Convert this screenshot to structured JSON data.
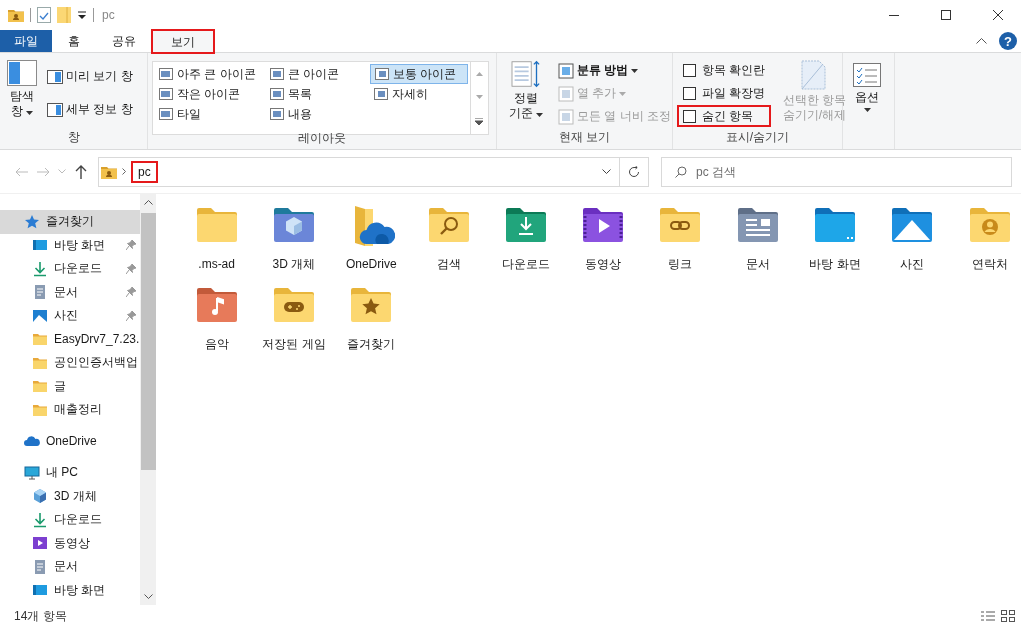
{
  "window": {
    "title": "pc"
  },
  "ribbon": {
    "tabs": [
      {
        "label": "파일",
        "kind": "file",
        "selected": false,
        "highlighted": false
      },
      {
        "label": "홈",
        "kind": "tab",
        "selected": false,
        "highlighted": false
      },
      {
        "label": "공유",
        "kind": "tab",
        "selected": false,
        "highlighted": false
      },
      {
        "label": "보기",
        "kind": "tab",
        "selected": true,
        "highlighted": true
      }
    ],
    "help": "?",
    "groups": [
      {
        "kind": "pane",
        "title": "창",
        "large": {
          "label": "탐색 창"
        },
        "items": [
          {
            "label": "미리 보기 창"
          },
          {
            "label": "세부 정보 창"
          }
        ]
      },
      {
        "kind": "layout",
        "title": "레이아웃",
        "items": [
          {
            "label": "아주 큰 아이콘",
            "selected": false
          },
          {
            "label": "큰 아이콘",
            "selected": false
          },
          {
            "label": "보통 아이콘",
            "selected": true
          },
          {
            "label": "작은 아이콘",
            "selected": false
          },
          {
            "label": "목록",
            "selected": false
          },
          {
            "label": "자세히",
            "selected": false
          },
          {
            "label": "타일",
            "selected": false
          },
          {
            "label": "내용",
            "selected": false
          }
        ]
      },
      {
        "kind": "current_view",
        "title": "현재 보기",
        "large": {
          "label": "정렬 기준"
        },
        "items": [
          {
            "label": "분류 방법",
            "disabled": false
          },
          {
            "label": "열 추가",
            "disabled": true
          },
          {
            "label": "모든 열 너비 조정",
            "disabled": true
          }
        ]
      },
      {
        "kind": "show_hide",
        "title": "표시/숨기기",
        "checkboxes": [
          {
            "label": "항목 확인란",
            "checked": false,
            "highlighted": false
          },
          {
            "label": "파일 확장명",
            "checked": false,
            "highlighted": false
          },
          {
            "label": "숨긴 항목",
            "checked": false,
            "highlighted": true
          }
        ],
        "large": {
          "label": "선택한 항목 숨기기/해제",
          "disabled": true
        }
      },
      {
        "kind": "options",
        "large": {
          "label": "옵션"
        }
      }
    ]
  },
  "address_bar": {
    "path": [
      {
        "label": "pc",
        "highlighted": true
      }
    ],
    "search": {
      "placeholder": "pc 검색"
    }
  },
  "navigation_pane": {
    "items": [
      {
        "label": "즐겨찾기",
        "kind": "star",
        "selected": true,
        "children": [
          {
            "label": "바탕 화면",
            "kind": "desktop",
            "selected": false,
            "pinned": true
          },
          {
            "label": "다운로드",
            "kind": "download",
            "selected": false,
            "pinned": true
          },
          {
            "label": "문서",
            "kind": "documents",
            "selected": false,
            "pinned": true
          },
          {
            "label": "사진",
            "kind": "pictures",
            "selected": false,
            "pinned": true
          },
          {
            "label": "EasyDrv7_7.23.",
            "kind": "folder",
            "selected": false,
            "pinned": false
          },
          {
            "label": "공인인증서백업",
            "kind": "folder",
            "selected": false,
            "pinned": false
          },
          {
            "label": "글",
            "kind": "folder",
            "selected": false,
            "pinned": false
          },
          {
            "label": "매출정리",
            "kind": "folder",
            "selected": false,
            "pinned": false
          }
        ]
      },
      {
        "label": "OneDrive",
        "kind": "onedrive",
        "selected": false
      },
      {
        "label": "내 PC",
        "kind": "pc",
        "selected": false,
        "children": [
          {
            "label": "3D 개체",
            "kind": "cube",
            "selected": false,
            "pinned": false
          },
          {
            "label": "다운로드",
            "kind": "download",
            "selected": false,
            "pinned": false
          },
          {
            "label": "동영상",
            "kind": "video",
            "selected": false,
            "pinned": false
          },
          {
            "label": "문서",
            "kind": "documents",
            "selected": false,
            "pinned": false
          },
          {
            "label": "바탕 화면",
            "kind": "desktop",
            "selected": false,
            "pinned": false
          }
        ]
      }
    ]
  },
  "files": [
    {
      "name": ".ms-ad",
      "kind": "folder"
    },
    {
      "name": "3D 개체",
      "kind": "cube"
    },
    {
      "name": "OneDrive",
      "kind": "onedrive"
    },
    {
      "name": "검색",
      "kind": "search"
    },
    {
      "name": "다운로드",
      "kind": "download"
    },
    {
      "name": "동영상",
      "kind": "video"
    },
    {
      "name": "링크",
      "kind": "link"
    },
    {
      "name": "문서",
      "kind": "documents"
    },
    {
      "name": "바탕 화면",
      "kind": "desktop"
    },
    {
      "name": "사진",
      "kind": "pictures"
    },
    {
      "name": "연락처",
      "kind": "contacts"
    },
    {
      "name": "음악",
      "kind": "music"
    },
    {
      "name": "저장된 게임",
      "kind": "games"
    },
    {
      "name": "즐겨찾기",
      "kind": "favorites"
    }
  ],
  "status_bar": {
    "count": "14개 항목"
  }
}
